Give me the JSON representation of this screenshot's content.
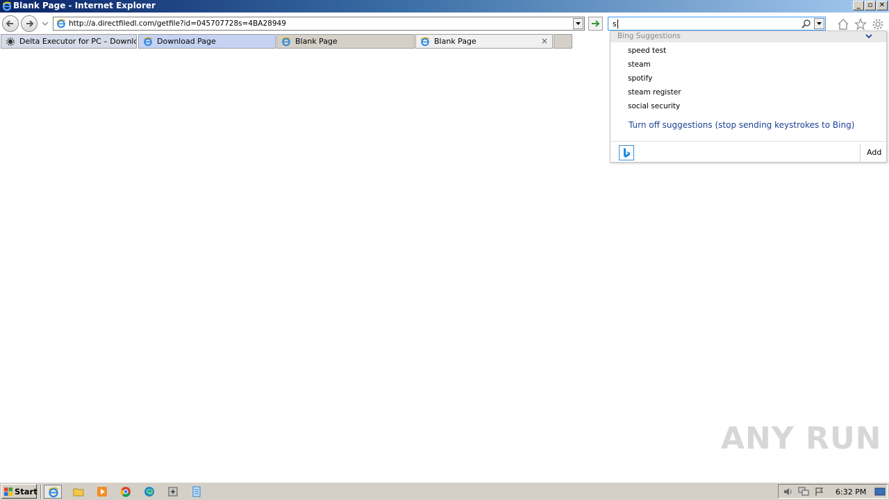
{
  "window": {
    "title": "Blank Page - Internet Explorer",
    "controls": {
      "minimize": "_",
      "maximize": "▫",
      "close": "✕"
    }
  },
  "navigation": {
    "address_url": "http://a.directfiledl.com/getfile?id=045707728s=4BA28949",
    "search_value": "s"
  },
  "tabs": [
    {
      "label": "Delta Executor for PC – Downlo...",
      "icon": "gear-favicon",
      "active": false
    },
    {
      "label": "Download Page",
      "icon": "ie-icon",
      "active": false
    },
    {
      "label": "Blank Page",
      "icon": "ie-icon",
      "active": false
    },
    {
      "label": "Blank Page",
      "icon": "ie-icon",
      "active": true,
      "close": "×"
    }
  ],
  "suggestions": {
    "header": "Bing Suggestions",
    "items": [
      "speed test",
      "steam",
      "spotify",
      "steam register",
      "social security"
    ],
    "turn_off": "Turn off suggestions (stop sending keystrokes to Bing)",
    "add_label": "Add"
  },
  "watermark": "ANY  RUN",
  "taskbar": {
    "start_label": "Start",
    "clock": "6:32 PM"
  },
  "colors": {
    "title_gradient_start": "#0a246a",
    "title_gradient_end": "#a6caf0",
    "taskbar": "#d4d0c8",
    "link": "#1c3f94",
    "search_border": "#3399ff"
  }
}
